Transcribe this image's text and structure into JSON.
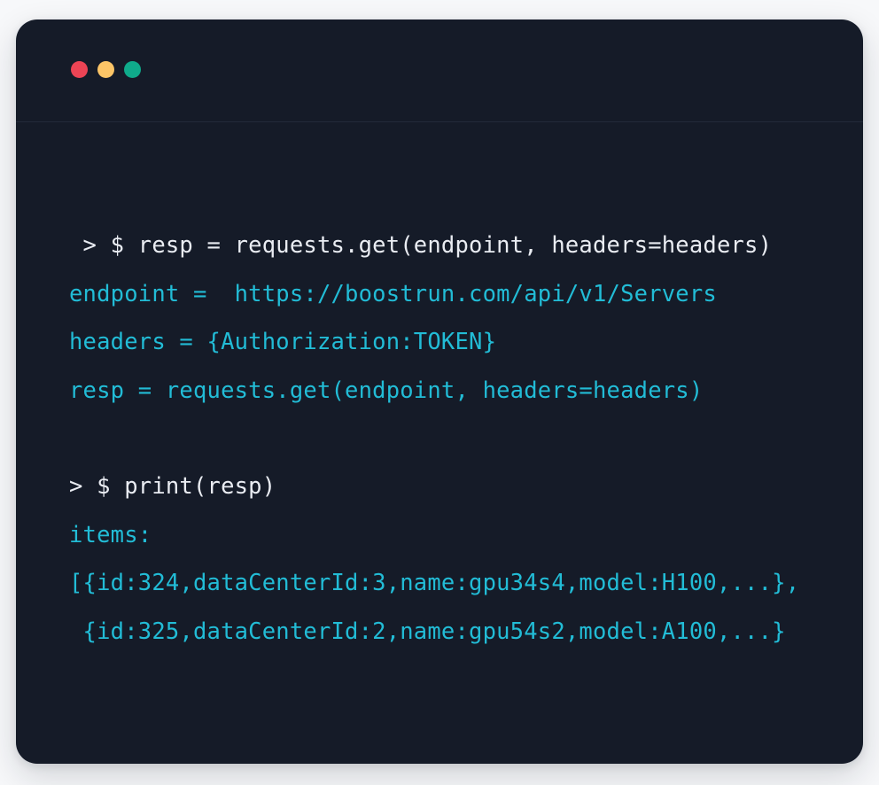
{
  "window": {
    "name": "terminal-window",
    "background_color": "#151b28",
    "page_background_color": "#f7f8fa",
    "titlebar": {
      "buttons": [
        {
          "name": "close",
          "color": "#ec4455"
        },
        {
          "name": "minimize",
          "color": "#fcc567"
        },
        {
          "name": "maximize",
          "color": "#0fab8b"
        }
      ]
    }
  },
  "colors": {
    "prompt_text": "#e9ecf2",
    "code_text": "#22bcd6",
    "divider": "#232a3a"
  },
  "terminal": {
    "lines": [
      {
        "id": "line-1",
        "type": "prompt",
        "text": " > $ resp = requests.get(endpoint, headers=headers)"
      },
      {
        "id": "line-2",
        "type": "code",
        "text": "endpoint =  https://boostrun.com/api/v1/Servers"
      },
      {
        "id": "line-3",
        "type": "code",
        "text": "headers = {Authorization:TOKEN}"
      },
      {
        "id": "line-4",
        "type": "code",
        "text": "resp = requests.get(endpoint, headers=headers)"
      },
      {
        "id": "line-5",
        "type": "spacer",
        "text": " "
      },
      {
        "id": "line-6",
        "type": "prompt",
        "text": "> $ print(resp)"
      },
      {
        "id": "line-7",
        "type": "code",
        "text": "items:"
      },
      {
        "id": "line-8",
        "type": "code",
        "text": "[{id:324,dataCenterId:3,name:gpu34s4,model:H100,...},"
      },
      {
        "id": "line-9",
        "type": "code",
        "text": " {id:325,dataCenterId:2,name:gpu54s2,model:A100,...}"
      }
    ]
  }
}
